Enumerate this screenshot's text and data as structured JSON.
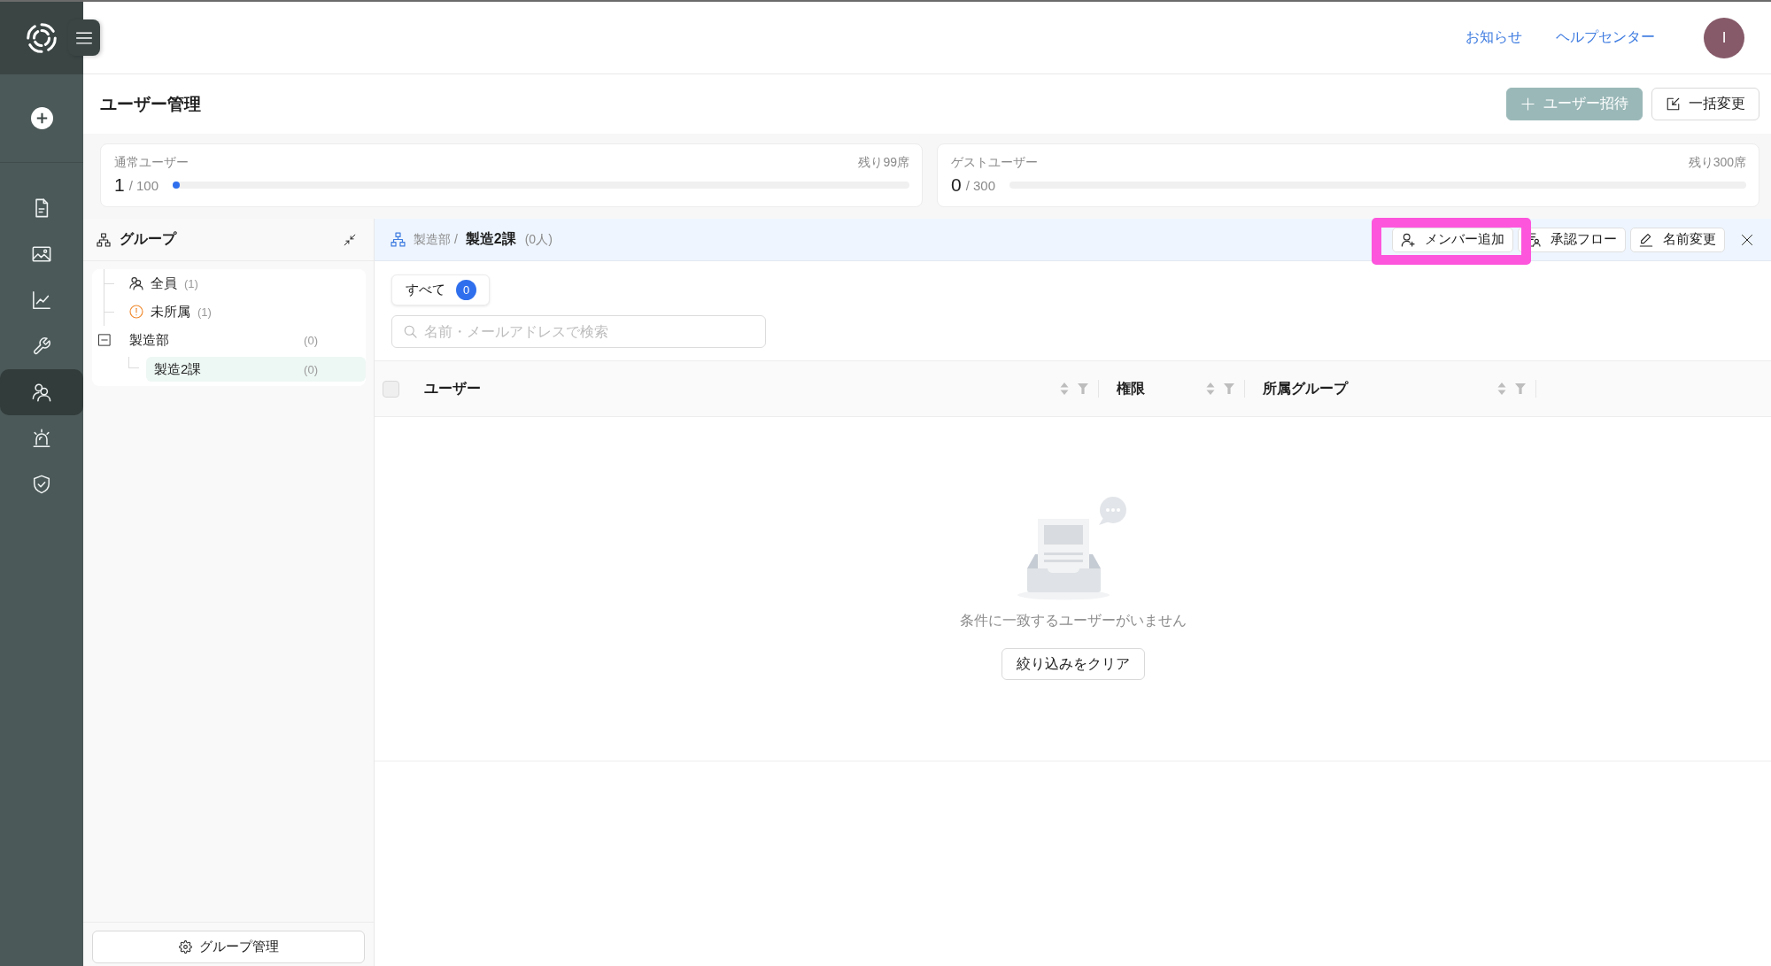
{
  "header": {
    "links": [
      "お知らせ",
      "ヘルプセンター"
    ],
    "avatar": "I"
  },
  "sidebar": {
    "nav_items": [
      {
        "selected": false
      },
      {
        "selected": false
      },
      {
        "selected": false
      },
      {
        "selected": false
      },
      {
        "selected": true
      },
      {
        "selected": false
      },
      {
        "selected": false
      }
    ]
  },
  "page": {
    "title": "ユーザー管理",
    "actions": [
      {
        "kind": "primary",
        "label": "ユーザー招待"
      },
      {
        "kind": "default",
        "label": "一括変更"
      }
    ]
  },
  "seat_cards": [
    {
      "label": "通常ユーザー",
      "remaining": "残り99席",
      "count": "1",
      "total": "/ 100",
      "level": 0.01
    },
    {
      "label": "ゲストユーザー",
      "remaining": "残り300席",
      "count": "0",
      "total": "/ 300"
    }
  ],
  "group_panel": {
    "title": "グループ",
    "tree": [
      {
        "kind": "all",
        "label": "全員",
        "count": "(1)",
        "selected": false
      },
      {
        "kind": "unassigned",
        "label": "未所属",
        "count": "(1)",
        "selected": false
      },
      {
        "kind": "department",
        "label": "製造部",
        "count": "(0)",
        "selected": false,
        "expanded": true,
        "children": [
          {
            "kind": "section",
            "label": "製造2課",
            "count": "(0)",
            "selected": true
          }
        ]
      }
    ],
    "manage_button": "グループ管理"
  },
  "group_detail": {
    "breadcrumb": {
      "parent": "製造部 /",
      "current": "製造2課",
      "member_count": "(0人)"
    },
    "actions": [
      {
        "label": "メンバー追加",
        "highlighted": true
      },
      {
        "label": "承認フロー",
        "highlighted": false
      },
      {
        "label": "名前変更",
        "highlighted": false
      }
    ],
    "filter_tabs": [
      {
        "label": "すべて",
        "count": "0",
        "selected": true
      }
    ],
    "search": {
      "placeholder": "名前・メールアドレスで検索"
    },
    "table": {
      "select_all": {
        "checked": false,
        "disabled": true
      },
      "columns": [
        "ユーザー",
        "権限",
        "所属グループ"
      ]
    },
    "empty_state": {
      "message": "条件に一致するユーザーがいません",
      "button": "絞り込みをクリア"
    }
  }
}
